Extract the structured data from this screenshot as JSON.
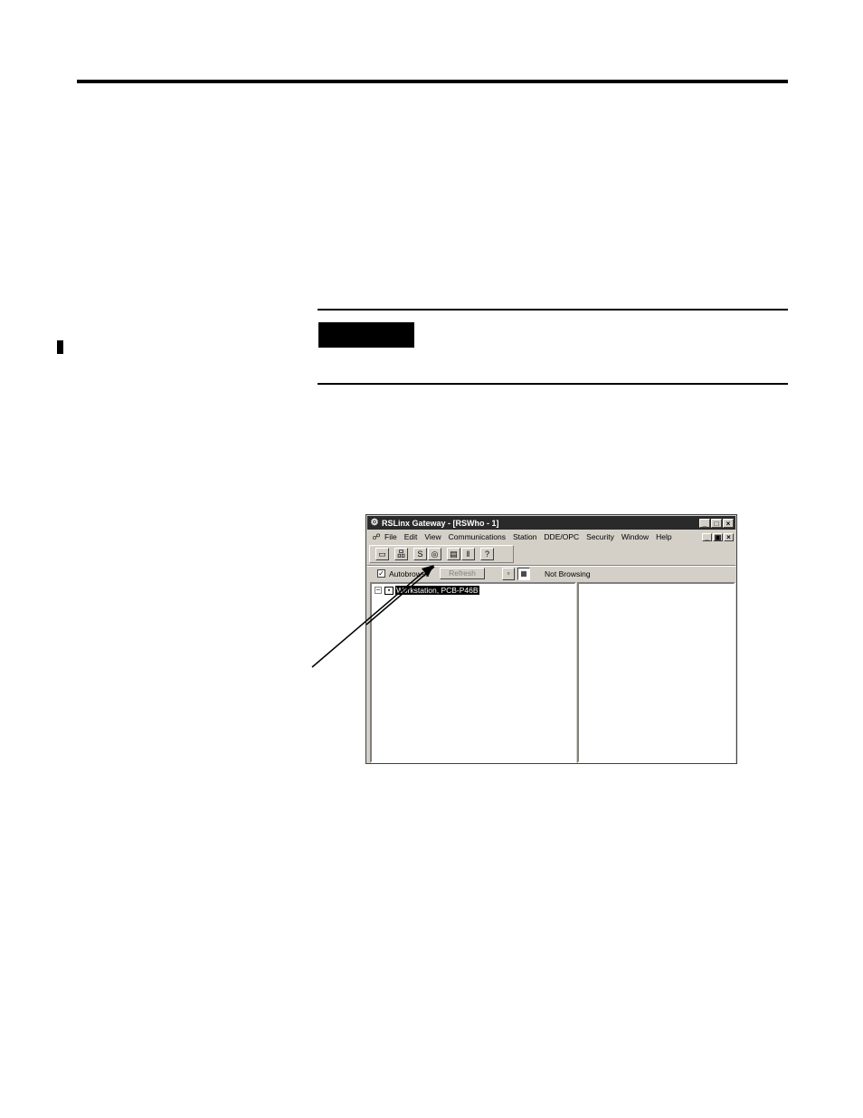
{
  "window": {
    "title": "RSLinx Gateway - [RSWho - 1]",
    "title_buttons": [
      "_",
      "□",
      "×"
    ],
    "menu": [
      "File",
      "Edit",
      "View",
      "Communications",
      "Station",
      "DDE/OPC",
      "Security",
      "Window",
      "Help"
    ],
    "mdi_buttons": [
      "_",
      "▣",
      "×"
    ]
  },
  "toolbar": {
    "icons": [
      "open-icon",
      "network-icon",
      "configure-drivers-icon",
      "device-properties-icon",
      "station-icon",
      "diagnostics-icon",
      "help-icon"
    ]
  },
  "browse": {
    "autobrowse_label": "Autobrowse",
    "autobrowse_checked": "✓",
    "refresh_label": "Refresh",
    "status": "Not Browsing"
  },
  "tree": {
    "expander": "−",
    "root_label": "Workstation, PCB-P46B"
  }
}
